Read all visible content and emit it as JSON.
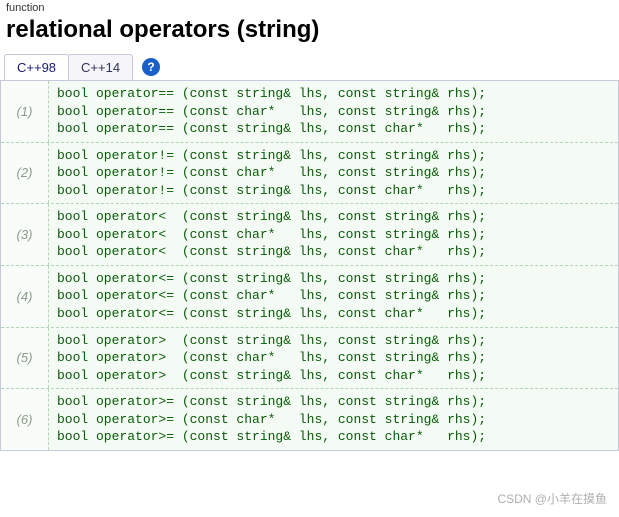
{
  "category": "function",
  "title": "relational operators (string)",
  "tabs": [
    {
      "label": "C++98",
      "active": true
    },
    {
      "label": "C++14",
      "active": false
    }
  ],
  "help_glyph": "?",
  "declarations": [
    {
      "num": "(1)",
      "lines": [
        "bool operator== (const string& lhs, const string& rhs);",
        "bool operator== (const char*   lhs, const string& rhs);",
        "bool operator== (const string& lhs, const char*   rhs);"
      ]
    },
    {
      "num": "(2)",
      "lines": [
        "bool operator!= (const string& lhs, const string& rhs);",
        "bool operator!= (const char*   lhs, const string& rhs);",
        "bool operator!= (const string& lhs, const char*   rhs);"
      ]
    },
    {
      "num": "(3)",
      "lines": [
        "bool operator<  (const string& lhs, const string& rhs);",
        "bool operator<  (const char*   lhs, const string& rhs);",
        "bool operator<  (const string& lhs, const char*   rhs);"
      ]
    },
    {
      "num": "(4)",
      "lines": [
        "bool operator<= (const string& lhs, const string& rhs);",
        "bool operator<= (const char*   lhs, const string& rhs);",
        "bool operator<= (const string& lhs, const char*   rhs);"
      ]
    },
    {
      "num": "(5)",
      "lines": [
        "bool operator>  (const string& lhs, const string& rhs);",
        "bool operator>  (const char*   lhs, const string& rhs);",
        "bool operator>  (const string& lhs, const char*   rhs);"
      ]
    },
    {
      "num": "(6)",
      "lines": [
        "bool operator>= (const string& lhs, const string& rhs);",
        "bool operator>= (const char*   lhs, const string& rhs);",
        "bool operator>= (const string& lhs, const char*   rhs);"
      ]
    }
  ],
  "watermark": "CSDN @小羊在摸鱼"
}
